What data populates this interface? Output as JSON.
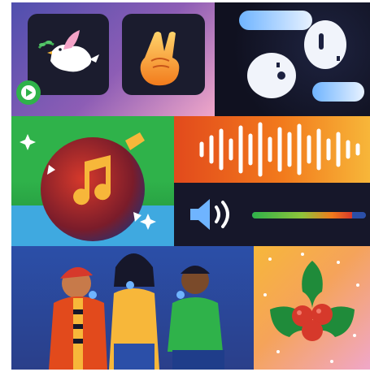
{
  "tiles": [
    {
      "name": "peace-dove-tile",
      "icon": "dove-with-olive-branch-icon"
    },
    {
      "name": "peace-hand-tile",
      "icon": "peace-sign-hand-icon"
    },
    {
      "name": "earbuds-tile",
      "icon": "wireless-earbuds-icon"
    },
    {
      "name": "music-ornament-tile",
      "icon": "music-note-ornament-icon"
    },
    {
      "name": "sound-wave-tile",
      "icon": "sound-wave-icon"
    },
    {
      "name": "volume-tile",
      "icon": "speaker-volume-icon"
    },
    {
      "name": "singers-tile",
      "icon": "karaoke-singers-illustration"
    },
    {
      "name": "holly-tile",
      "icon": "holly-leaves-berries-icon"
    }
  ],
  "volume": {
    "level": 0.88
  },
  "colors": {
    "green": "#2fb24a",
    "orange": "#f26a1b",
    "blue": "#2b4fa8",
    "pink": "#f0a7c9",
    "dark": "#16172a",
    "yellow": "#f7b73a"
  }
}
